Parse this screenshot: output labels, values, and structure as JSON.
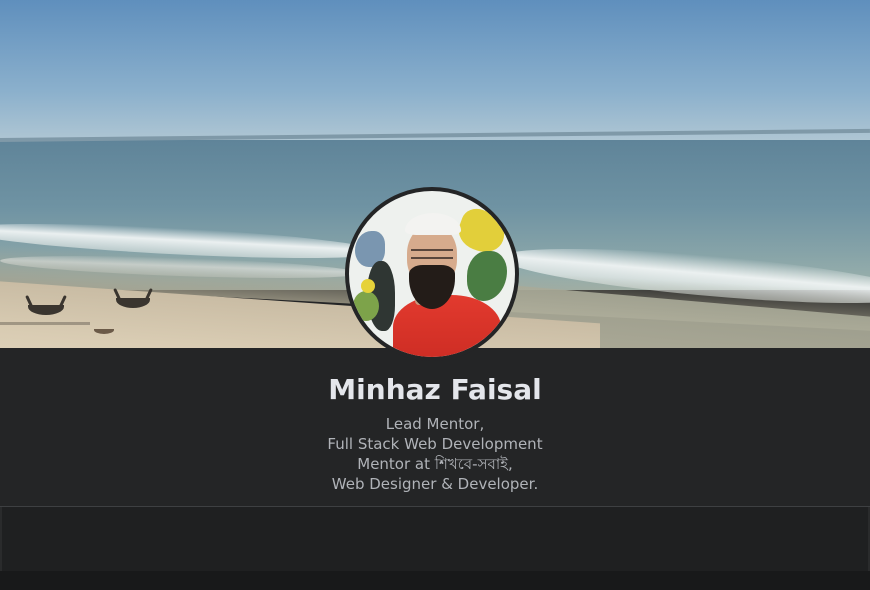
{
  "profile": {
    "name": "Minhaz Faisal",
    "bio_lines": [
      "Lead Mentor,",
      "Full Stack Web Development",
      "Mentor at শিখবে-সবাই,",
      "Web Designer & Developer."
    ]
  },
  "colors": {
    "background": "#242526",
    "name_text": "#e4e6eb",
    "bio_text": "#b0b3b8",
    "tab_bar": "#1f2021"
  },
  "icons": {
    "cover": "cover-photo",
    "avatar": "profile-picture"
  }
}
